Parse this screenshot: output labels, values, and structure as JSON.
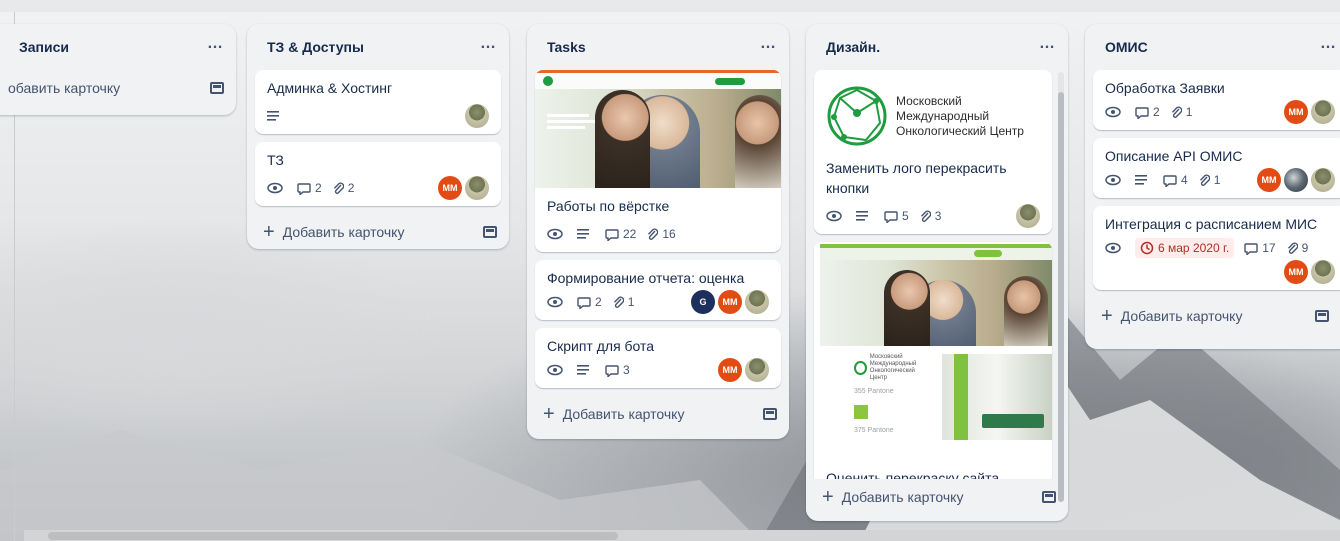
{
  "board": {
    "lists": [
      {
        "title": "Записи",
        "add_label": "обавить карточку",
        "cards": []
      },
      {
        "title": "ТЗ & Доступы",
        "add_label": "Добавить карточку",
        "cards": [
          {
            "title": "Админка & Хостинг"
          },
          {
            "title": "ТЗ",
            "comments": "2",
            "attachments": "2",
            "members": [
              "ММ"
            ]
          }
        ]
      },
      {
        "title": "Tasks",
        "add_label": "Добавить карточку",
        "cards": [
          {
            "title": "Работы по вёрстке",
            "comments": "22",
            "attachments": "16"
          },
          {
            "title": "Формирование отчета: оценка",
            "comments": "2",
            "attachments": "1",
            "members": [
              "G",
              "ММ"
            ]
          },
          {
            "title": "Скрипт для бота",
            "comments": "3",
            "members": [
              "ММ"
            ]
          }
        ]
      },
      {
        "title": "Дизайн.",
        "add_label": "Добавить карточку",
        "cards": [
          {
            "title": "Заменить лого перекрасить кнопки",
            "comments": "5",
            "attachments": "3",
            "logo_text": [
              "Московский",
              "Международный",
              "Онкологический Центр"
            ]
          },
          {
            "title": "Оценить перекраску сайта",
            "cover_labels": [
              "Московский",
              "Международный",
              "Онкологический Центр",
              "355 Pantone",
              "375 Pantone"
            ]
          }
        ]
      },
      {
        "title": "ОМИС",
        "add_label": "Добавить карточку",
        "cards": [
          {
            "title": "Обработка Заявки",
            "comments": "2",
            "attachments": "1",
            "members": [
              "ММ"
            ]
          },
          {
            "title": "Описание API ОМИС",
            "comments": "4",
            "attachments": "1",
            "members": [
              "ММ"
            ]
          },
          {
            "title": "Интеграция с расписанием МИС",
            "due_date": "6 мар 2020 г.",
            "comments": "17",
            "attachments": "9",
            "members": [
              "ММ"
            ]
          }
        ]
      }
    ],
    "colors": {
      "list_bg": "#f1f2f4",
      "member_mm": "#e34b14",
      "member_g": "#1d2f5c",
      "due_bg": "#ffeceb",
      "accent_green": "#1e9c3f"
    }
  }
}
